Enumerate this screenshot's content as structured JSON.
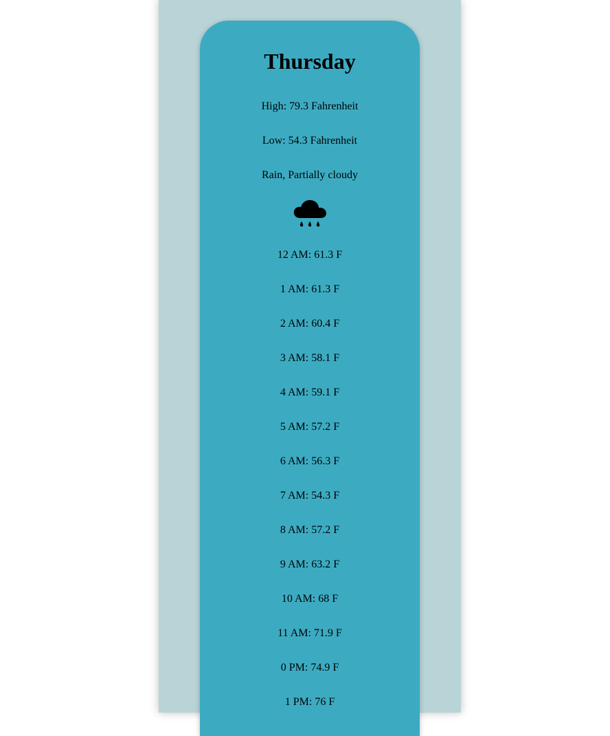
{
  "day": {
    "title": "Thursday",
    "high": "High: 79.3 Fahrenheit",
    "low": "Low: 54.3 Fahrenheit",
    "conditions": "Rain, Partially cloudy",
    "icon": "rain-cloud-icon"
  },
  "hourly": [
    "12 AM: 61.3 F",
    "1 AM: 61.3 F",
    "2 AM: 60.4 F",
    "3 AM: 58.1 F",
    "4 AM: 59.1 F",
    "5 AM: 57.2 F",
    "6 AM: 56.3 F",
    "7 AM: 54.3 F",
    "8 AM: 57.2 F",
    "9 AM: 63.2 F",
    "10 AM: 68 F",
    "11 AM: 71.9 F",
    "0 PM: 74.9 F",
    "1 PM: 76 F"
  ],
  "colors": {
    "page_background": "#ffffff",
    "column_background": "#b9d4d7",
    "card_background": "#3cabc2"
  }
}
